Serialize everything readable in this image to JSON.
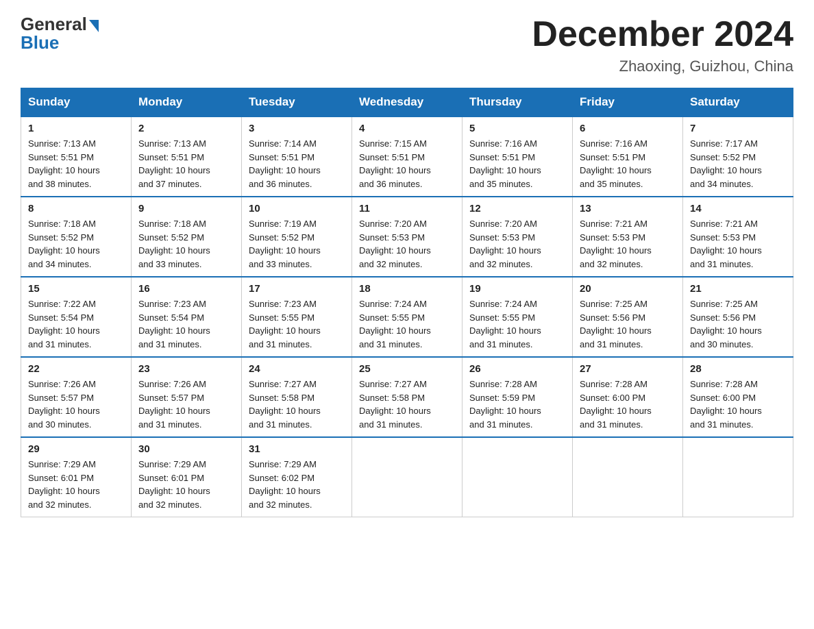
{
  "header": {
    "logo_general": "General",
    "logo_blue": "Blue",
    "month_title": "December 2024",
    "location": "Zhaoxing, Guizhou, China"
  },
  "days_of_week": [
    "Sunday",
    "Monday",
    "Tuesday",
    "Wednesday",
    "Thursday",
    "Friday",
    "Saturday"
  ],
  "weeks": [
    [
      {
        "day": "1",
        "sunrise": "7:13 AM",
        "sunset": "5:51 PM",
        "daylight": "10 hours and 38 minutes."
      },
      {
        "day": "2",
        "sunrise": "7:13 AM",
        "sunset": "5:51 PM",
        "daylight": "10 hours and 37 minutes."
      },
      {
        "day": "3",
        "sunrise": "7:14 AM",
        "sunset": "5:51 PM",
        "daylight": "10 hours and 36 minutes."
      },
      {
        "day": "4",
        "sunrise": "7:15 AM",
        "sunset": "5:51 PM",
        "daylight": "10 hours and 36 minutes."
      },
      {
        "day": "5",
        "sunrise": "7:16 AM",
        "sunset": "5:51 PM",
        "daylight": "10 hours and 35 minutes."
      },
      {
        "day": "6",
        "sunrise": "7:16 AM",
        "sunset": "5:51 PM",
        "daylight": "10 hours and 35 minutes."
      },
      {
        "day": "7",
        "sunrise": "7:17 AM",
        "sunset": "5:52 PM",
        "daylight": "10 hours and 34 minutes."
      }
    ],
    [
      {
        "day": "8",
        "sunrise": "7:18 AM",
        "sunset": "5:52 PM",
        "daylight": "10 hours and 34 minutes."
      },
      {
        "day": "9",
        "sunrise": "7:18 AM",
        "sunset": "5:52 PM",
        "daylight": "10 hours and 33 minutes."
      },
      {
        "day": "10",
        "sunrise": "7:19 AM",
        "sunset": "5:52 PM",
        "daylight": "10 hours and 33 minutes."
      },
      {
        "day": "11",
        "sunrise": "7:20 AM",
        "sunset": "5:53 PM",
        "daylight": "10 hours and 32 minutes."
      },
      {
        "day": "12",
        "sunrise": "7:20 AM",
        "sunset": "5:53 PM",
        "daylight": "10 hours and 32 minutes."
      },
      {
        "day": "13",
        "sunrise": "7:21 AM",
        "sunset": "5:53 PM",
        "daylight": "10 hours and 32 minutes."
      },
      {
        "day": "14",
        "sunrise": "7:21 AM",
        "sunset": "5:53 PM",
        "daylight": "10 hours and 31 minutes."
      }
    ],
    [
      {
        "day": "15",
        "sunrise": "7:22 AM",
        "sunset": "5:54 PM",
        "daylight": "10 hours and 31 minutes."
      },
      {
        "day": "16",
        "sunrise": "7:23 AM",
        "sunset": "5:54 PM",
        "daylight": "10 hours and 31 minutes."
      },
      {
        "day": "17",
        "sunrise": "7:23 AM",
        "sunset": "5:55 PM",
        "daylight": "10 hours and 31 minutes."
      },
      {
        "day": "18",
        "sunrise": "7:24 AM",
        "sunset": "5:55 PM",
        "daylight": "10 hours and 31 minutes."
      },
      {
        "day": "19",
        "sunrise": "7:24 AM",
        "sunset": "5:55 PM",
        "daylight": "10 hours and 31 minutes."
      },
      {
        "day": "20",
        "sunrise": "7:25 AM",
        "sunset": "5:56 PM",
        "daylight": "10 hours and 31 minutes."
      },
      {
        "day": "21",
        "sunrise": "7:25 AM",
        "sunset": "5:56 PM",
        "daylight": "10 hours and 30 minutes."
      }
    ],
    [
      {
        "day": "22",
        "sunrise": "7:26 AM",
        "sunset": "5:57 PM",
        "daylight": "10 hours and 30 minutes."
      },
      {
        "day": "23",
        "sunrise": "7:26 AM",
        "sunset": "5:57 PM",
        "daylight": "10 hours and 31 minutes."
      },
      {
        "day": "24",
        "sunrise": "7:27 AM",
        "sunset": "5:58 PM",
        "daylight": "10 hours and 31 minutes."
      },
      {
        "day": "25",
        "sunrise": "7:27 AM",
        "sunset": "5:58 PM",
        "daylight": "10 hours and 31 minutes."
      },
      {
        "day": "26",
        "sunrise": "7:28 AM",
        "sunset": "5:59 PM",
        "daylight": "10 hours and 31 minutes."
      },
      {
        "day": "27",
        "sunrise": "7:28 AM",
        "sunset": "6:00 PM",
        "daylight": "10 hours and 31 minutes."
      },
      {
        "day": "28",
        "sunrise": "7:28 AM",
        "sunset": "6:00 PM",
        "daylight": "10 hours and 31 minutes."
      }
    ],
    [
      {
        "day": "29",
        "sunrise": "7:29 AM",
        "sunset": "6:01 PM",
        "daylight": "10 hours and 32 minutes."
      },
      {
        "day": "30",
        "sunrise": "7:29 AM",
        "sunset": "6:01 PM",
        "daylight": "10 hours and 32 minutes."
      },
      {
        "day": "31",
        "sunrise": "7:29 AM",
        "sunset": "6:02 PM",
        "daylight": "10 hours and 32 minutes."
      },
      null,
      null,
      null,
      null
    ]
  ],
  "labels": {
    "sunrise": "Sunrise:",
    "sunset": "Sunset:",
    "daylight": "Daylight:"
  }
}
